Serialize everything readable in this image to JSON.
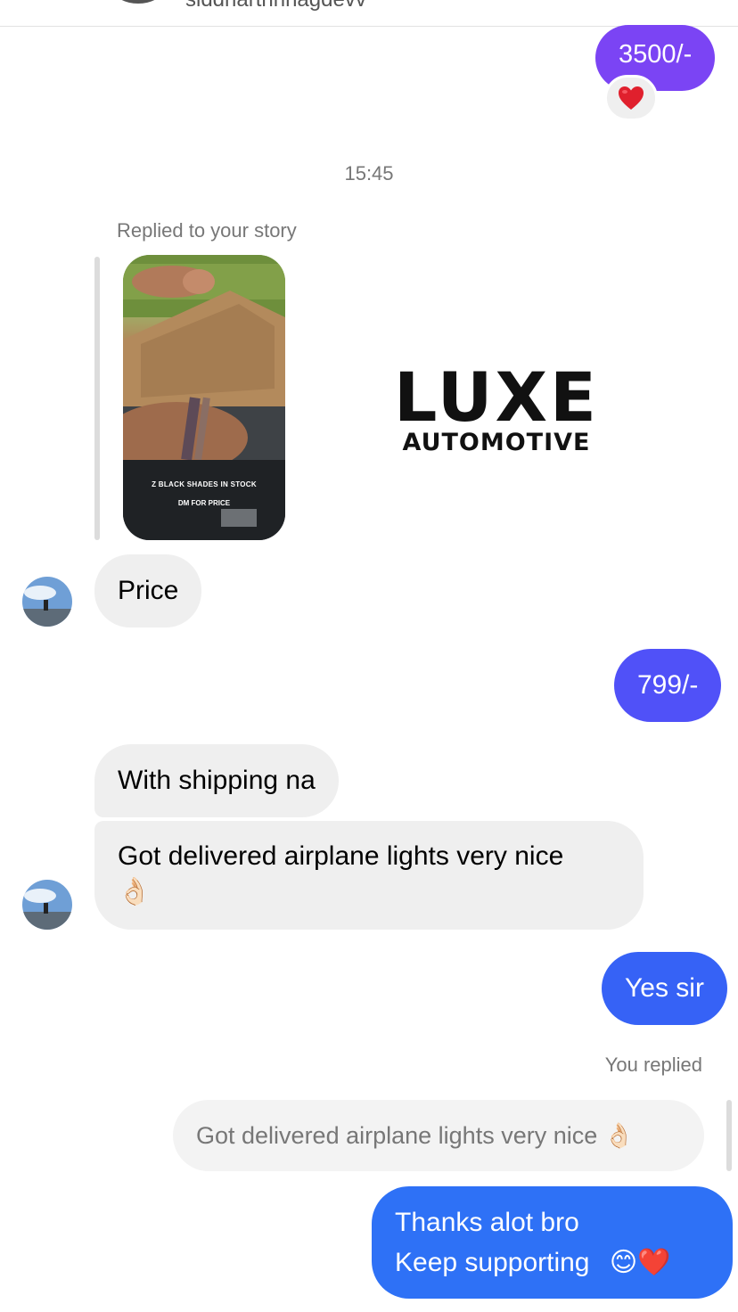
{
  "header": {
    "username": "siddharthhhagdevv"
  },
  "messages": {
    "m1": {
      "text": "3500/-",
      "color": "#7b44f4",
      "reaction": "red-heart"
    },
    "time": "15:45",
    "story_reply_label": "Replied to your story",
    "story": {
      "caption_line1": "Z BLACK SHADES IN STOCK",
      "caption_line2": "DM FOR PRICE",
      "brand_main": "LUXE",
      "brand_sub": "AUTOMOTIVE"
    },
    "m2": {
      "text": "Price"
    },
    "m3": {
      "text": "799/-",
      "color": "#5051f8"
    },
    "m4": {
      "text": "With shipping na"
    },
    "m5": {
      "line1": "Got delivered airplane lights very nice",
      "emoji": "👌🏻"
    },
    "m6": {
      "text": "Yes sir",
      "color": "#3662f6"
    },
    "you_replied": "You replied",
    "quoted": {
      "text": "Got delivered airplane lights very nice",
      "emoji": "👌🏻"
    },
    "m7": {
      "line1": "Thanks alot bro",
      "line2": "Keep supporting",
      "emoji": "😊❤️",
      "color": "#2e71f6"
    }
  }
}
